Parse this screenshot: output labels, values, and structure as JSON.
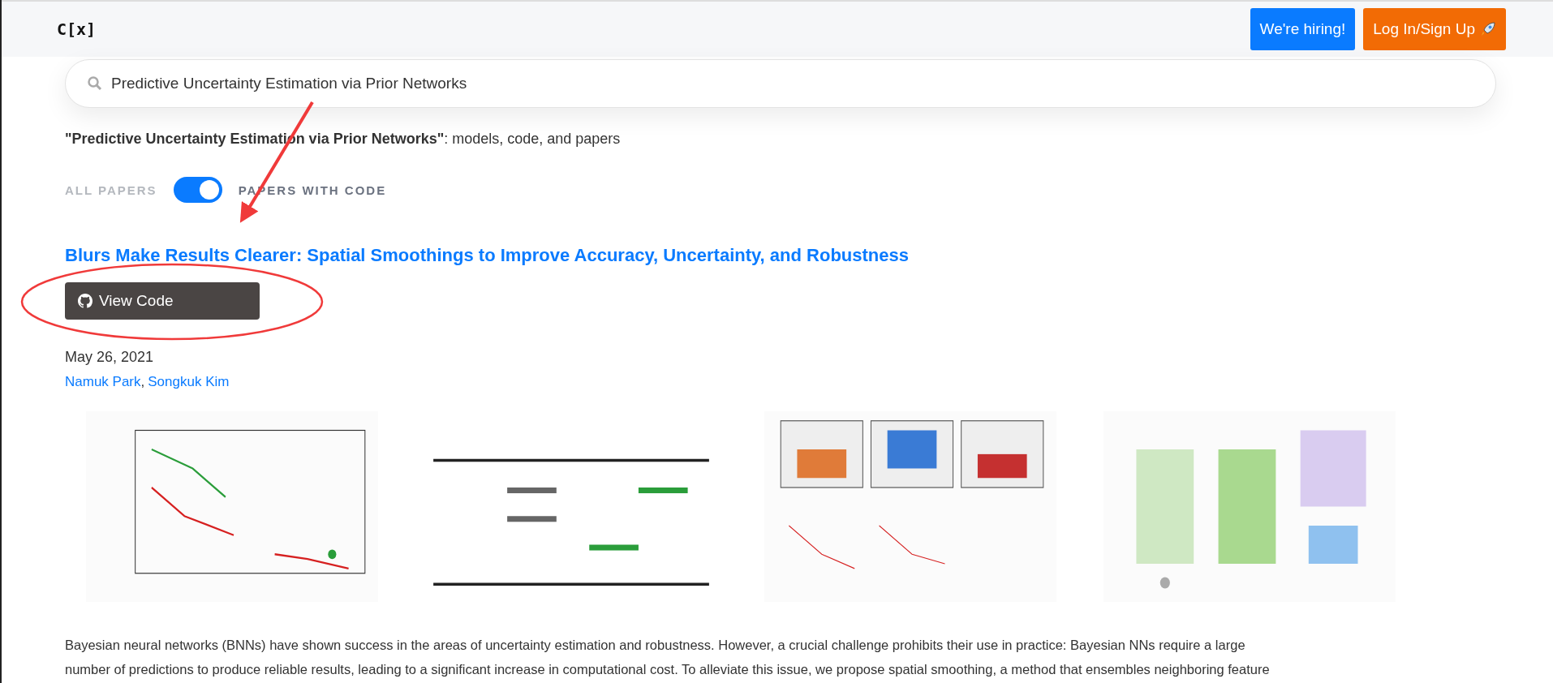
{
  "header": {
    "logo": "C[x]",
    "buttons": [
      {
        "label": "We're hiring!",
        "kind": "hiring"
      },
      {
        "label": "Log In/Sign Up",
        "kind": "login"
      }
    ]
  },
  "search": {
    "value": "Predictive Uncertainty Estimation via Prior Networks"
  },
  "query_summary": "**\"Predictive Uncertainty Estimation via Prior Networks\"**: models, code, and papers",
  "filter": {
    "left_label": "ALL PAPERS",
    "right_label": "PAPERS WITH CODE",
    "on": true
  },
  "paper": {
    "title": "Blurs Make Results Clearer: Spatial Smoothings to Improve Accuracy, Uncertainty, and Robustness",
    "code_button": "View Code",
    "date": "May 26, 2021",
    "authors": [
      "Namuk Park",
      "Songkuk Kim"
    ],
    "author_separator": ",",
    "abstract_lines": [
      "Bayesian neural networks (BNNs) have shown success in the areas of uncertainty estimation and robustness. However, a crucial challenge prohibits their use in practice: Bayesian NNs require a large",
      "number of predictions to produce reliable results, leading to a significant increase in computational cost. To alleviate this issue, we propose spatial smoothing, a method that ensembles neighboring feature"
    ]
  },
  "annotations": [
    {
      "kind": "arrow"
    },
    {
      "kind": "ellipse"
    }
  ]
}
